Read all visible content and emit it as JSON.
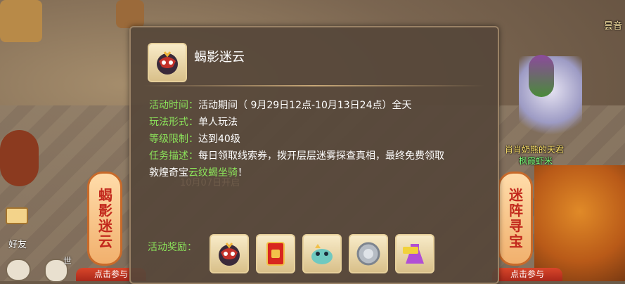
{
  "background": {
    "corner_name": "昙音",
    "npc_title": "肖肖奶熊的天君",
    "npc_name": "枫霞虾米",
    "left_side_tag": "蝎影迷云",
    "right_side_tag": "迷阵寻宝",
    "left_click_label": "点击参与",
    "right_click_label": "点击参与",
    "friend_label": "好友",
    "world_label": "世"
  },
  "panel": {
    "title": "蝎影迷云",
    "activity_time_label": "活动时间：",
    "activity_time_value": "活动期间（ 9月29日12点-10月13日24点）全天",
    "play_mode_label": "玩法形式：",
    "play_mode_value": "单人玩法",
    "level_label": "等级限制：",
    "level_value": "达到40级",
    "task_label": "任务描述：",
    "task_value_line1": "每日领取线索券，拨开层层迷雾探查真相，最终免费领取",
    "task_value_line2a": "敦煌奇宝",
    "task_value_line2b": "云纹蝎坐骑",
    "task_value_line2c": "！",
    "rewards_label": "活动奖励：",
    "watermark": "10月07日开启"
  },
  "rewards": [
    {
      "icon": "scorpion-mask-icon",
      "color": "#c4312a"
    },
    {
      "icon": "red-envelope-icon",
      "color": "#d8261e"
    },
    {
      "icon": "cloud-pet-icon",
      "color": "#6fc9c0"
    },
    {
      "icon": "silver-coin-icon",
      "color": "#b6bcc4"
    },
    {
      "icon": "exp-potion-icon",
      "color": "#b14fd6"
    }
  ]
}
